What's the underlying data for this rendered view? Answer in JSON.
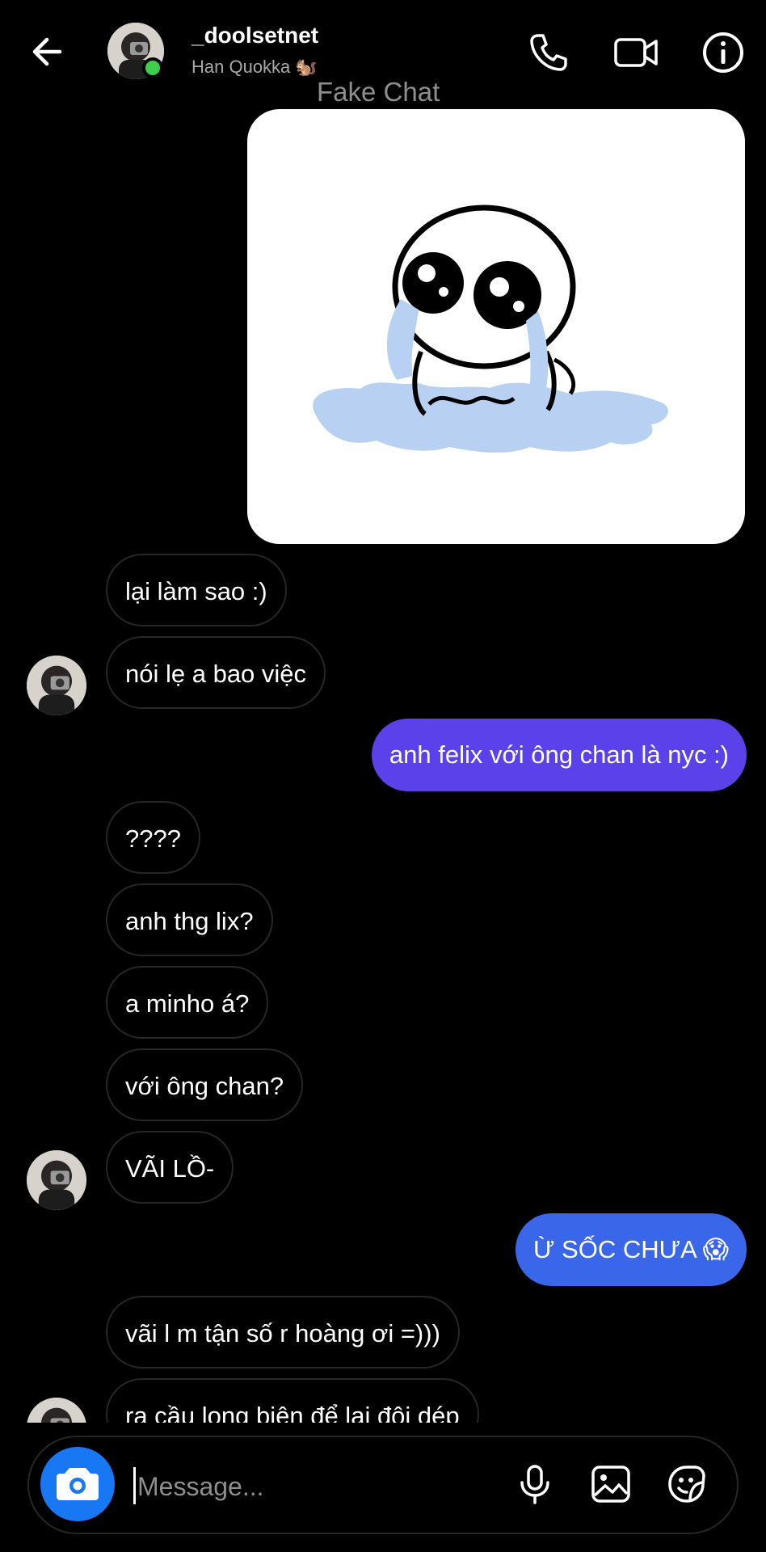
{
  "header": {
    "username": "_doolsetnet",
    "subname": "Han Quokka 🐿️",
    "watermark": "Fake Chat"
  },
  "messages": [
    {
      "type": "image",
      "from": "me",
      "image": "crying cartoon ghost sticker"
    },
    {
      "type": "text",
      "from": "them",
      "text": "lại làm sao :)"
    },
    {
      "type": "text",
      "from": "them",
      "text": "nói lẹ a bao việc",
      "avatar": true
    },
    {
      "type": "text",
      "from": "me",
      "text": "anh felix với ông chan là nyc :)"
    },
    {
      "type": "text",
      "from": "them",
      "text": "????"
    },
    {
      "type": "text",
      "from": "them",
      "text": "anh thg lix?"
    },
    {
      "type": "text",
      "from": "them",
      "text": "a minho á?"
    },
    {
      "type": "text",
      "from": "them",
      "text": "với ông chan?"
    },
    {
      "type": "text",
      "from": "them",
      "text": "VÃI LỒ-",
      "avatar": true
    },
    {
      "type": "text",
      "from": "me",
      "text": "Ừ SỐC CHƯA 😱"
    },
    {
      "type": "text",
      "from": "them",
      "text": "vãi l m tận số r hoàng ơi =)))"
    },
    {
      "type": "text",
      "from": "them",
      "text": "ra cầu long biên để lại đôi dép",
      "avatar": true
    }
  ],
  "composer": {
    "placeholder": "Message..."
  },
  "colors": {
    "background": "#000000",
    "bubble_purple": "#5b41e9",
    "bubble_blue": "#3a67ea",
    "camera_button": "#1877f2",
    "online_dot": "#3ccf4e"
  },
  "icons": [
    "back-arrow-icon",
    "phone-icon",
    "video-icon",
    "info-icon",
    "camera-icon",
    "microphone-icon",
    "gallery-icon",
    "sticker-icon"
  ]
}
